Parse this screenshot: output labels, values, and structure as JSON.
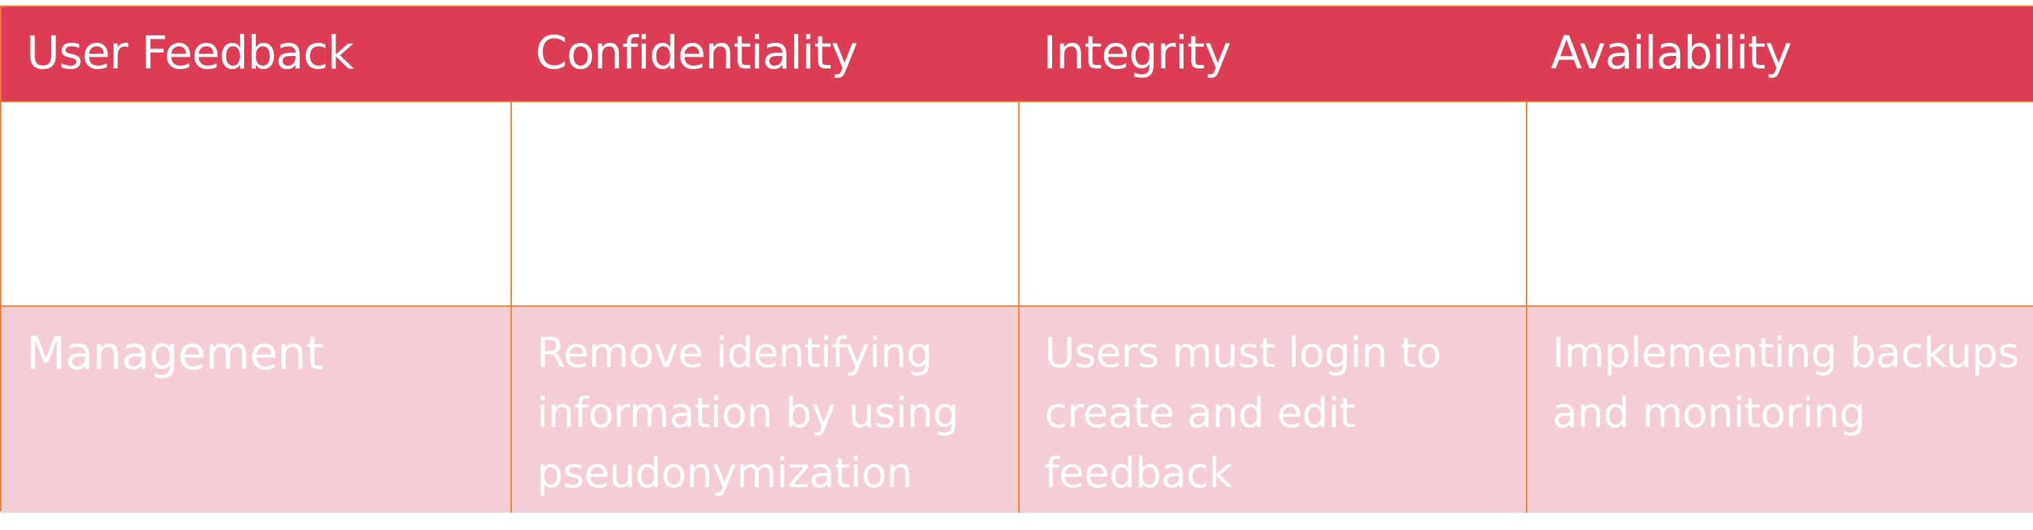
{
  "table": {
    "headers": [
      "User Feedback",
      "Confidentiality",
      "Integrity",
      "Availability"
    ],
    "rows": [
      {
        "label": "Management",
        "confidentiality": "Remove identifying information by using pseudonymization",
        "integrity": "Users must login to create and edit feedback",
        "availability": "Implementing backups and monitoring"
      }
    ]
  },
  "colors": {
    "header_bg": "#dc3d55",
    "row_bg": "#f5cdd4",
    "border": "#ed7d31",
    "text_on_color": "#ffffff"
  }
}
